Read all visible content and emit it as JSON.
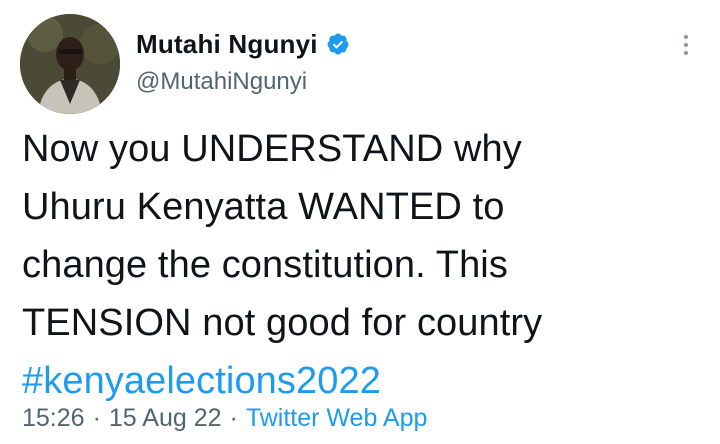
{
  "author": {
    "display_name": "Mutahi Ngunyi",
    "handle": "@MutahiNgunyi",
    "verified": true,
    "avatar_icon": "profile-photo"
  },
  "tweet": {
    "lines": [
      "Now you UNDERSTAND why",
      "Uhuru Kenyatta WANTED to",
      "change the constitution. This",
      "TENSION not good for country"
    ],
    "hashtag": "#kenyaelections2022"
  },
  "meta": {
    "time": "15:26",
    "separator": "·",
    "date": "15 Aug 22",
    "source": "Twitter Web App"
  },
  "colors": {
    "link": "#1d9bf0",
    "secondary_text": "#536471",
    "primary_text": "#0f1419"
  },
  "icons": {
    "verified": "verified-badge-icon",
    "more": "more-options-icon"
  }
}
